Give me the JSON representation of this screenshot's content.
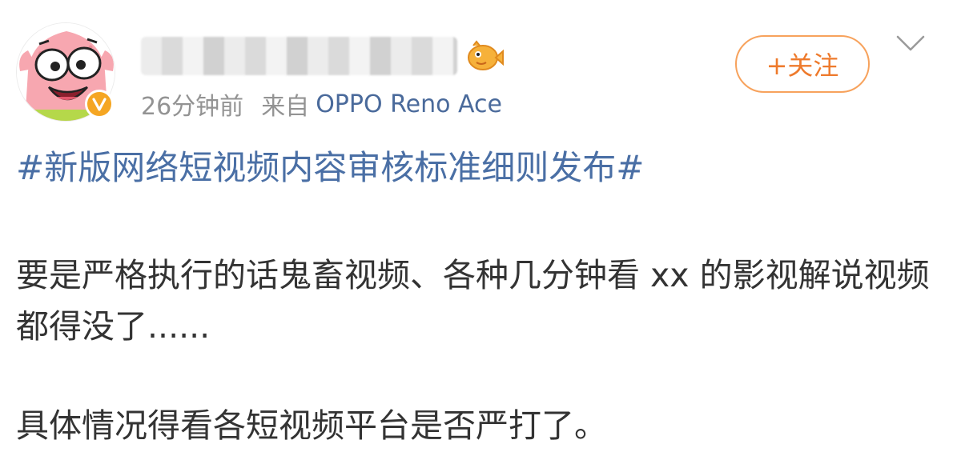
{
  "author": {
    "name_hidden": true,
    "verified": true
  },
  "meta": {
    "time": "26分钟前",
    "from_label": "来自",
    "device": "OPPO Reno Ace"
  },
  "actions": {
    "follow_label": "+关注"
  },
  "post": {
    "topic": "#新版网络短视频内容审核标准细则发布#",
    "paragraphs": [
      "要是严格执行的话鬼畜视频、各种几分钟看 xx 的影视解说视频都得没了......",
      "具体情况得看各短视频平台是否严打了。"
    ]
  },
  "colors": {
    "link": "#4a6fa5",
    "device_link": "#4a6a9b",
    "follow_accent": "#ee7a2c",
    "verified_badge": "#f5a623",
    "muted_text": "#939393"
  },
  "icons": {
    "avatar": "patrick-star-avatar",
    "verified": "verified-badge-icon",
    "fan": "fan-badge-fish-icon",
    "more": "chevron-down-icon"
  }
}
